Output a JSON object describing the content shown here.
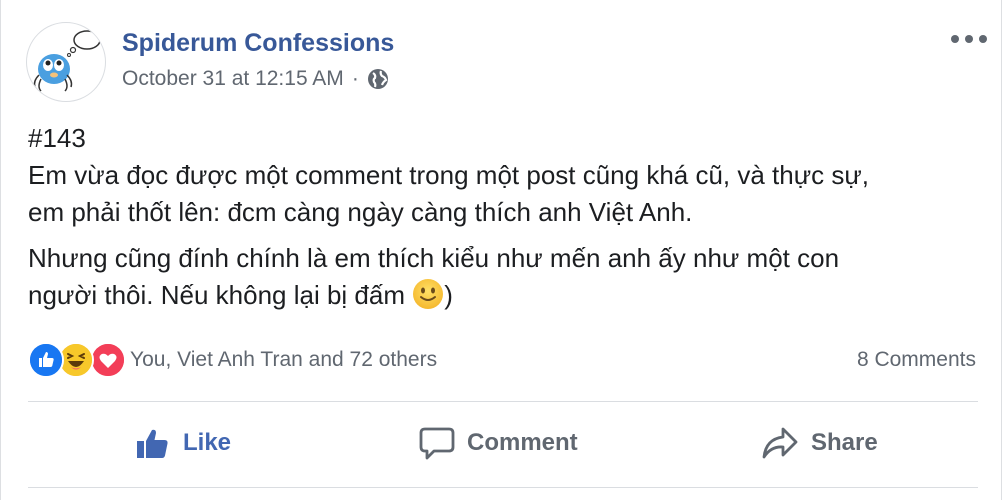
{
  "post": {
    "page_name": "Spiderum Confessions",
    "timestamp": "October 31 at 12:15 AM",
    "separator": "·",
    "privacy_icon": "globe-icon",
    "more_icon": "more-options-icon",
    "body": {
      "line1": "#143",
      "line2": "Em vừa đọc được một comment trong một post cũng khá cũ, và thực sự,",
      "line3": "em phải thốt lên: đcm càng ngày càng thích anh Việt Anh.",
      "line4": "Nhưng cũng đính chính là em thích kiểu như mến anh ấy như một con",
      "line5_before": "người thôi. Nếu không lại bị đấm ",
      "line5_after": ")",
      "emoji": "slightly-smiling-face-icon"
    },
    "reactions": {
      "icons": [
        "like-reaction-icon",
        "haha-reaction-icon",
        "love-reaction-icon"
      ],
      "summary": "You, Viet Anh Tran and 72 others"
    },
    "comments_count": "8 Comments",
    "actions": {
      "like": "Like",
      "comment": "Comment",
      "share": "Share"
    }
  },
  "colors": {
    "page_name": "#385898",
    "meta": "#606770",
    "like_active": "#4267b2",
    "love": "#f33e58",
    "haha": "#f7b125"
  }
}
